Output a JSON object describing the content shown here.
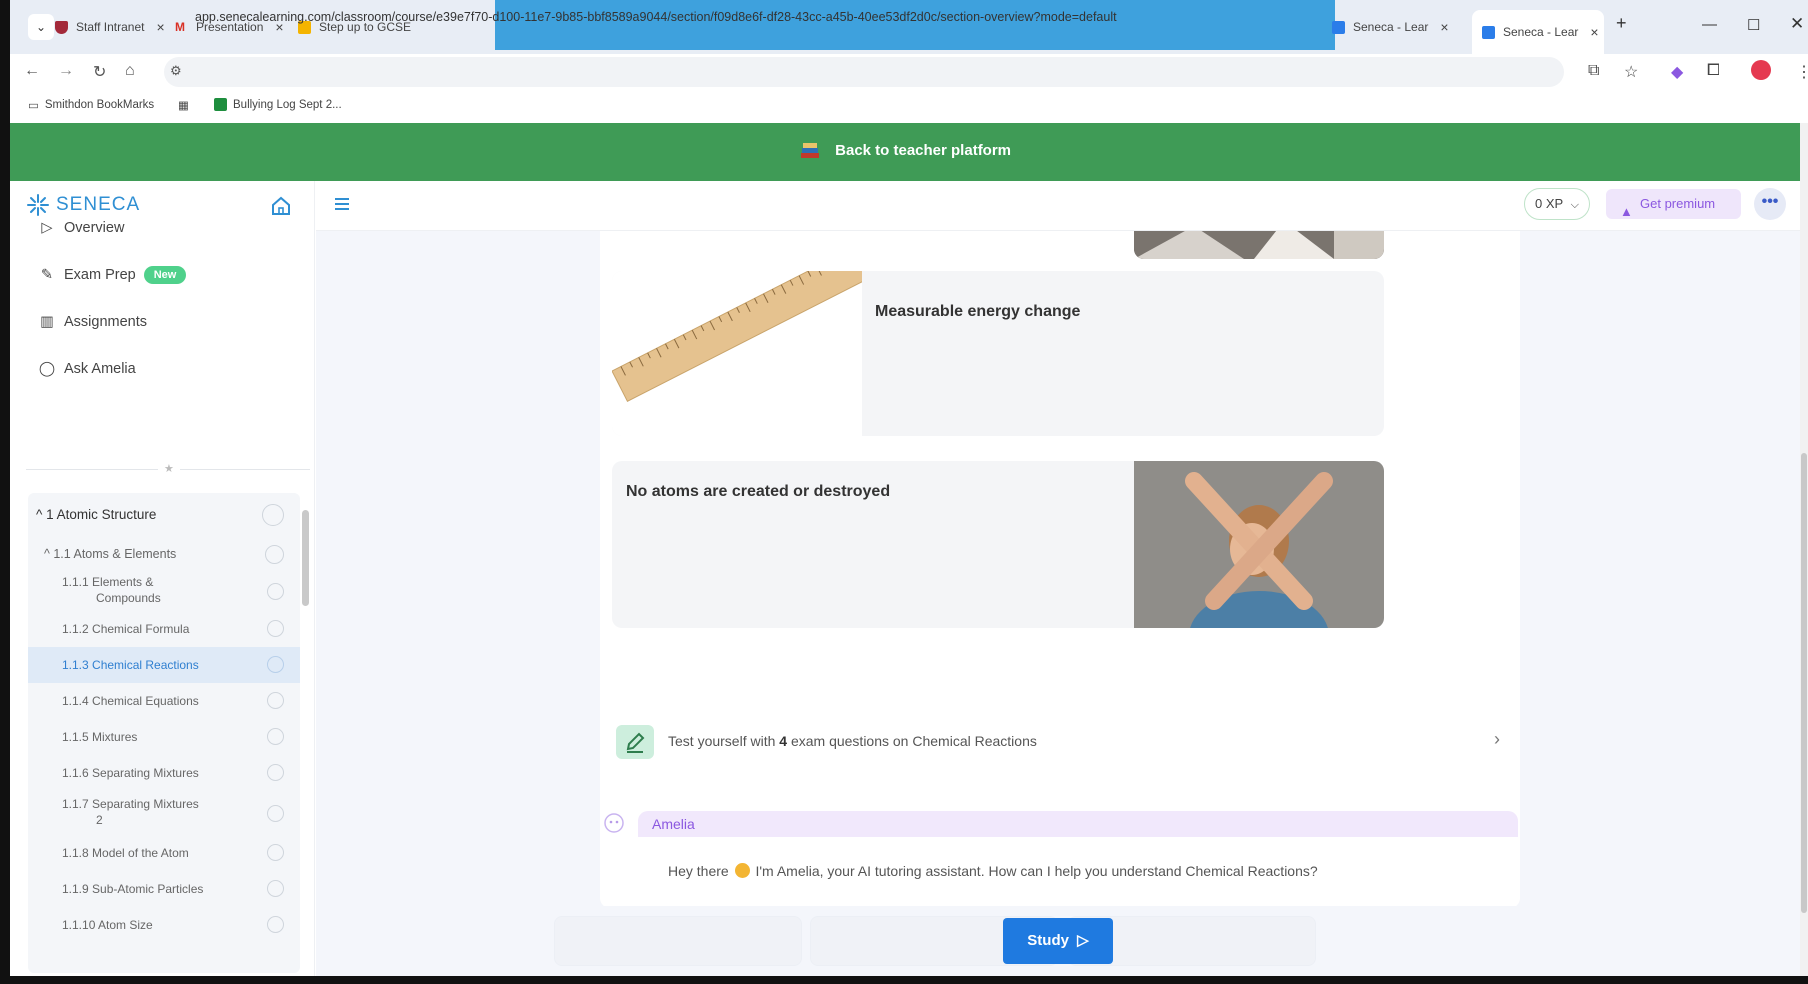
{
  "browser": {
    "tabs": [
      {
        "title": "Staff Intranet",
        "color": "#c0392b"
      },
      {
        "title": "Presentation",
        "color": "#d93025"
      },
      {
        "title": "Step up to GCSE",
        "color": "#f4b400"
      },
      {
        "title": "Seneca - Lear",
        "color": "#2b7de9"
      },
      {
        "title": "Seneca - Lear",
        "color": "#2b7de9"
      }
    ],
    "new_tab": "+",
    "close": "×",
    "url": "app.senecalearning.com/classroom/course/e39e7f70-d100-11e7-9b85-bbf8589a9044/section/f09d8e6f-df28-43cc-a45b-40ee53df2d0c/section-overview?mode=default",
    "bookmarks": [
      "Smithdon BookMarks",
      "Bullying Log Sept 2..."
    ]
  },
  "banner": {
    "label": "Back to teacher platform"
  },
  "sidebar": {
    "logo": "SENECA",
    "nav": [
      {
        "label": "Overview"
      },
      {
        "label": "Exam Prep",
        "badge": "New"
      },
      {
        "label": "Assignments"
      },
      {
        "label": "Ask Amelia"
      }
    ],
    "toc": [
      {
        "label": "^ 1 Atomic Structure"
      },
      {
        "label": "^ 1.1 Atoms & Elements"
      },
      {
        "label": "1.1.1 Elements &",
        "label2": "Compounds"
      },
      {
        "label": "1.1.2 Chemical Formula"
      },
      {
        "label": "1.1.3 Chemical Reactions",
        "active": true
      },
      {
        "label": "1.1.4 Chemical Equations"
      },
      {
        "label": "1.1.5 Mixtures"
      },
      {
        "label": "1.1.6 Separating Mixtures"
      },
      {
        "label": "1.1.7 Separating Mixtures",
        "label2": "2"
      },
      {
        "label": "1.1.8 Model of the Atom"
      },
      {
        "label": "1.1.9 Sub-Atomic Particles"
      },
      {
        "label": "1.1.10 Atom Size"
      }
    ]
  },
  "header": {
    "xp": "0 XP",
    "premium": "Get premium",
    "more": "•••"
  },
  "content": {
    "card1_title": "Measurable energy change",
    "card2_title": "No atoms are created or destroyed",
    "test_prefix": "Test yourself with ",
    "test_count": "4",
    "test_suffix": " exam questions on Chemical Reactions",
    "amelia_name": "Amelia",
    "amelia_msg_a": "Hey there ",
    "amelia_msg_b": " I'm Amelia, your AI tutoring assistant. How can I help you understand Chemical Reactions?",
    "study_button": "Study"
  },
  "colors": {
    "banner": "#3f9b56",
    "accent": "#1f7ae0",
    "premium": "#8b58e0"
  }
}
